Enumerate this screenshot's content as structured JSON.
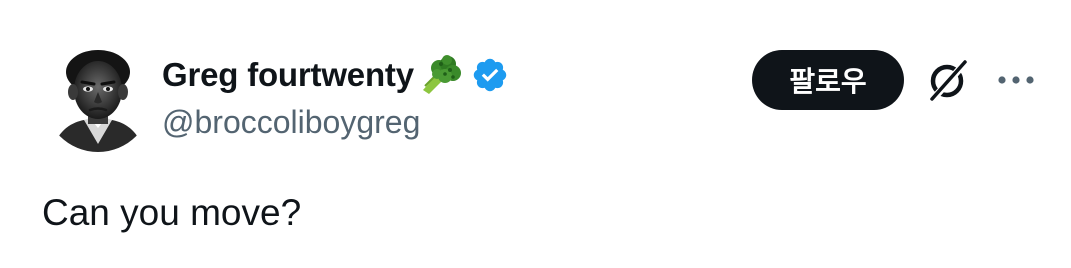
{
  "author": {
    "display_name": "Greg fourtwenty",
    "handle": "@broccoliboygreg",
    "avatar_icon": "portrait-avatar",
    "name_emoji": "broccoli-icon",
    "verified_badge": "verified-icon",
    "verified_color": "#1d9bf0"
  },
  "actions": {
    "follow_label": "팔로우",
    "grok_icon": "grok-icon",
    "more_icon": "more-options-icon"
  },
  "tweet": {
    "text": "Can you move?"
  },
  "colors": {
    "text_primary": "#0f1419",
    "text_secondary": "#536471",
    "button_bg": "#0f1419",
    "button_text": "#ffffff"
  }
}
